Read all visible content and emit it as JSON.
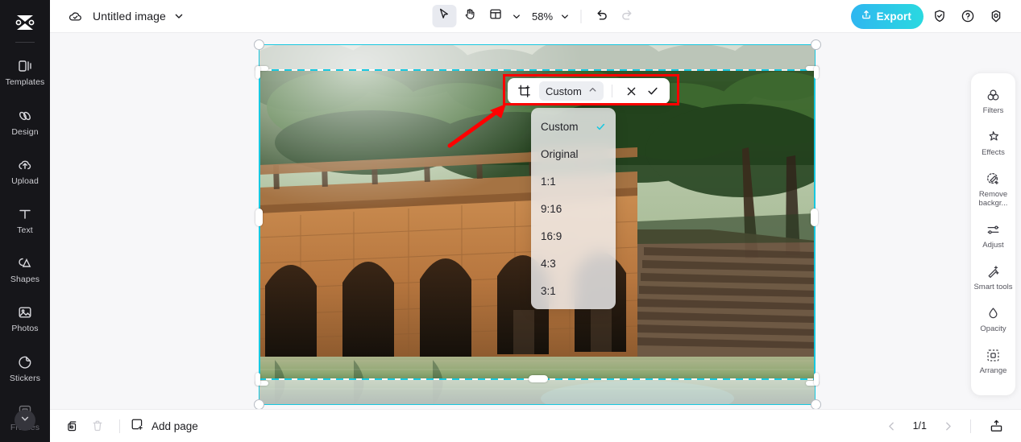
{
  "app": {
    "logo_icon": "capcut-logo-icon",
    "doc_title": "Untitled image",
    "cloud_icon": "cloud-saved-icon",
    "title_caret_icon": "chevron-down-icon"
  },
  "sidebar": {
    "items": [
      {
        "label": "Templates",
        "icon": "templates-icon",
        "dim": false
      },
      {
        "label": "Design",
        "icon": "design-icon",
        "dim": false
      },
      {
        "label": "Upload",
        "icon": "upload-cloud-icon",
        "dim": false
      },
      {
        "label": "Text",
        "icon": "text-icon",
        "dim": false
      },
      {
        "label": "Shapes",
        "icon": "shapes-icon",
        "dim": false
      },
      {
        "label": "Photos",
        "icon": "photos-icon",
        "dim": false
      },
      {
        "label": "Stickers",
        "icon": "stickers-icon",
        "dim": false
      },
      {
        "label": "Frames",
        "icon": "frames-icon",
        "dim": true
      }
    ],
    "more_icon": "chevron-down-circle-icon"
  },
  "toolbar": {
    "select_icon": "cursor-arrow-icon",
    "hand_icon": "hand-pan-icon",
    "layout_icon": "layout-grid-icon",
    "layout_caret_icon": "chevron-down-icon",
    "zoom_level": "58%",
    "zoom_caret_icon": "chevron-down-icon",
    "undo_icon": "undo-arrow-icon",
    "redo_icon": "redo-arrow-icon",
    "export_label": "Export",
    "export_icon": "share-upload-icon",
    "export_color_start": "#2fb6f0",
    "export_color_end": "#2ad9e0",
    "shield_icon": "shield-check-icon",
    "help_icon": "question-circle-icon",
    "settings_icon": "settings-gear-icon"
  },
  "crop_toolbar": {
    "crop_icon": "crop-tool-icon",
    "ratio_value": "Custom",
    "ratio_caret_icon": "chevron-up-icon",
    "cancel_icon": "close-x-icon",
    "confirm_icon": "check-icon",
    "highlight_color": "#ff0000"
  },
  "ratio_dropdown": {
    "selected": "Custom",
    "check_icon": "check-icon",
    "check_color": "#18c8e0",
    "options": [
      {
        "label": "Custom"
      },
      {
        "label": "Original"
      },
      {
        "label": "1:1"
      },
      {
        "label": "9:16"
      },
      {
        "label": "16:9"
      },
      {
        "label": "4:3"
      },
      {
        "label": "3:1"
      }
    ]
  },
  "canvas": {
    "selection_color": "#18c8e0",
    "image_alt": "stone arch bridge over green water with trees and steps"
  },
  "right_panel": {
    "items": [
      {
        "label": "Filters",
        "icon": "filters-icon"
      },
      {
        "label": "Effects",
        "icon": "effects-star-icon"
      },
      {
        "label": "Remove backgr...",
        "icon": "remove-background-icon"
      },
      {
        "label": "Adjust",
        "icon": "adjust-sliders-icon"
      },
      {
        "label": "Smart tools",
        "icon": "smart-tools-wand-icon"
      },
      {
        "label": "Opacity",
        "icon": "opacity-drop-icon"
      },
      {
        "label": "Arrange",
        "icon": "arrange-icon"
      }
    ]
  },
  "bottombar": {
    "duplicate_icon": "duplicate-page-icon",
    "delete_icon": "trash-delete-icon",
    "add_page_label": "Add page",
    "add_page_icon": "add-page-icon",
    "prev_icon": "chevron-left-icon",
    "page_indicator": "1/1",
    "next_icon": "chevron-right-icon",
    "present_icon": "present-export-icon"
  }
}
